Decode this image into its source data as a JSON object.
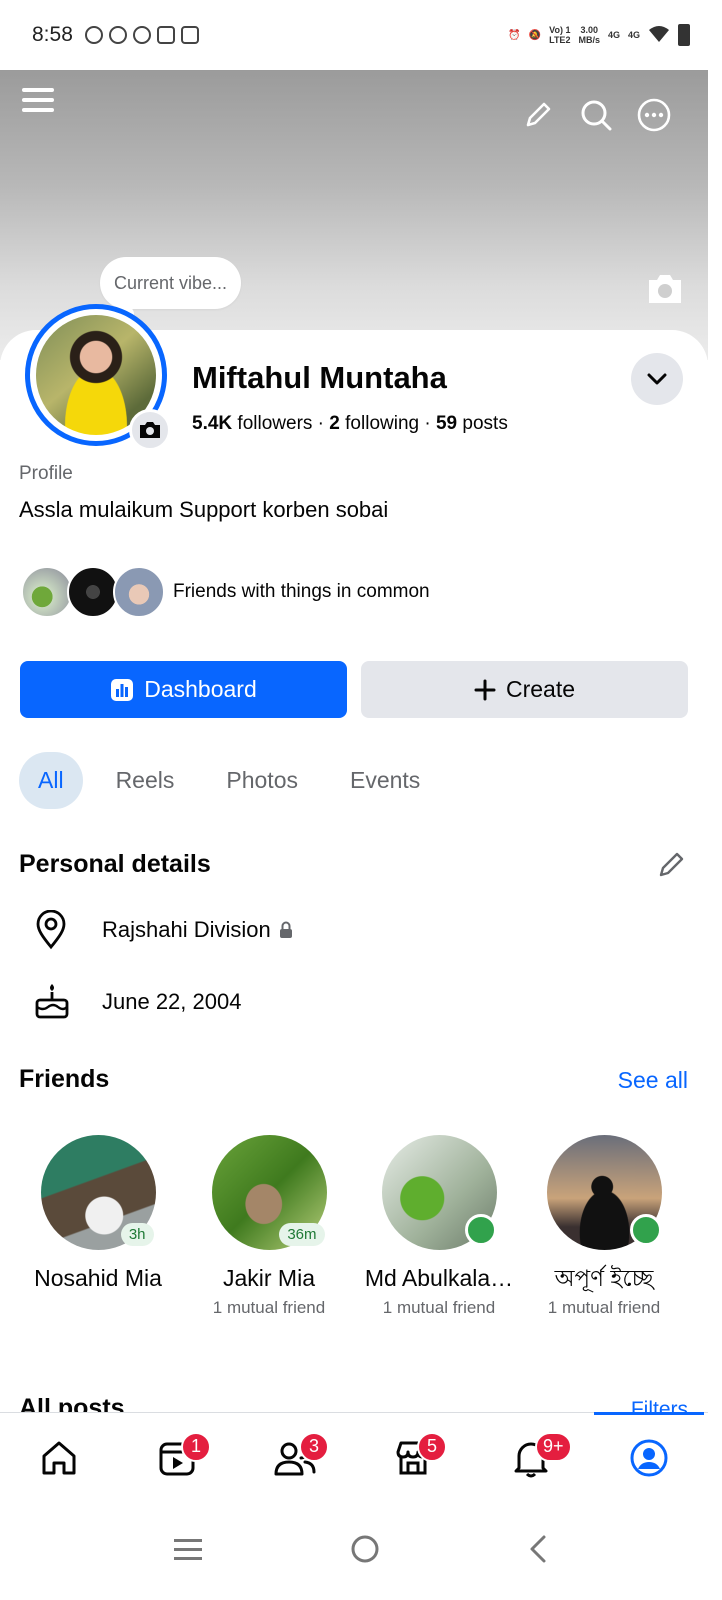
{
  "status_bar": {
    "time": "8:58",
    "network_1": "Vo) 1",
    "network_2": "LTE2",
    "speed": "3.00",
    "speed_unit": "MB/s",
    "signal_1": "4G",
    "signal_2": "4G"
  },
  "profile": {
    "current_vibe": "Current vibe...",
    "name": "Miftahul Muntaha",
    "followers_count": "5.4K",
    "followers_label": "followers",
    "following_count": "2",
    "following_label": "following",
    "posts_count": "59",
    "posts_label": "posts",
    "section_label": "Profile",
    "bio": "Assla mulaikum Support korben sobai",
    "friends_common": "Friends with things in common"
  },
  "actions": {
    "dashboard_label": "Dashboard",
    "create_label": "Create"
  },
  "tabs": [
    {
      "label": "All",
      "active": true
    },
    {
      "label": "Reels",
      "active": false
    },
    {
      "label": "Photos",
      "active": false
    },
    {
      "label": "Events",
      "active": false
    }
  ],
  "personal_details": {
    "title": "Personal details",
    "location": "Rajshahi Division",
    "birthday": "June 22, 2004"
  },
  "friends": {
    "title": "Friends",
    "see_all": "See all",
    "items": [
      {
        "name": "Nosahid Mia",
        "status": "3h",
        "mutual": ""
      },
      {
        "name": "Jakir Mia",
        "status": "36m",
        "mutual": "1 mutual friend"
      },
      {
        "name": "Md Abulkala…",
        "status": "online",
        "mutual": "1 mutual friend"
      },
      {
        "name": "অপূর্ণ ইচ্ছে",
        "status": "online",
        "mutual": "1 mutual friend"
      }
    ]
  },
  "all_posts": {
    "title": "All posts",
    "filters": "Filters"
  },
  "bottom_nav": [
    {
      "icon": "home-icon",
      "badge": ""
    },
    {
      "icon": "video-icon",
      "badge": "1"
    },
    {
      "icon": "friends-icon",
      "badge": "3"
    },
    {
      "icon": "marketplace-icon",
      "badge": "5"
    },
    {
      "icon": "bell-icon",
      "badge": "9+"
    },
    {
      "icon": "profile-icon",
      "badge": "",
      "active": true
    }
  ],
  "colors": {
    "primary": "#0866ff",
    "badge": "#e41e3f",
    "online": "#31a24c"
  }
}
